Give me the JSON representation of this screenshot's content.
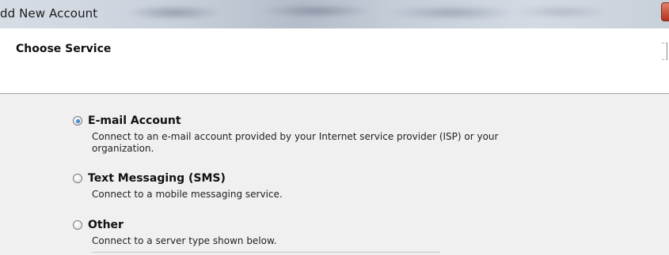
{
  "window": {
    "title": "dd New Account"
  },
  "header": {
    "heading": "Choose Service"
  },
  "options": [
    {
      "label": "E-mail Account",
      "checked": true,
      "description": "Connect to an e-mail account provided by your Internet service provider (ISP) or your organization."
    },
    {
      "label": "Text Messaging (SMS)",
      "checked": false,
      "description": "Connect to a mobile messaging service."
    },
    {
      "label": "Other",
      "checked": false,
      "description": "Connect to a server type shown below."
    }
  ],
  "icons": {
    "radio_selected": "radio-selected-icon",
    "radio_unselected": "radio-unselected-icon"
  }
}
